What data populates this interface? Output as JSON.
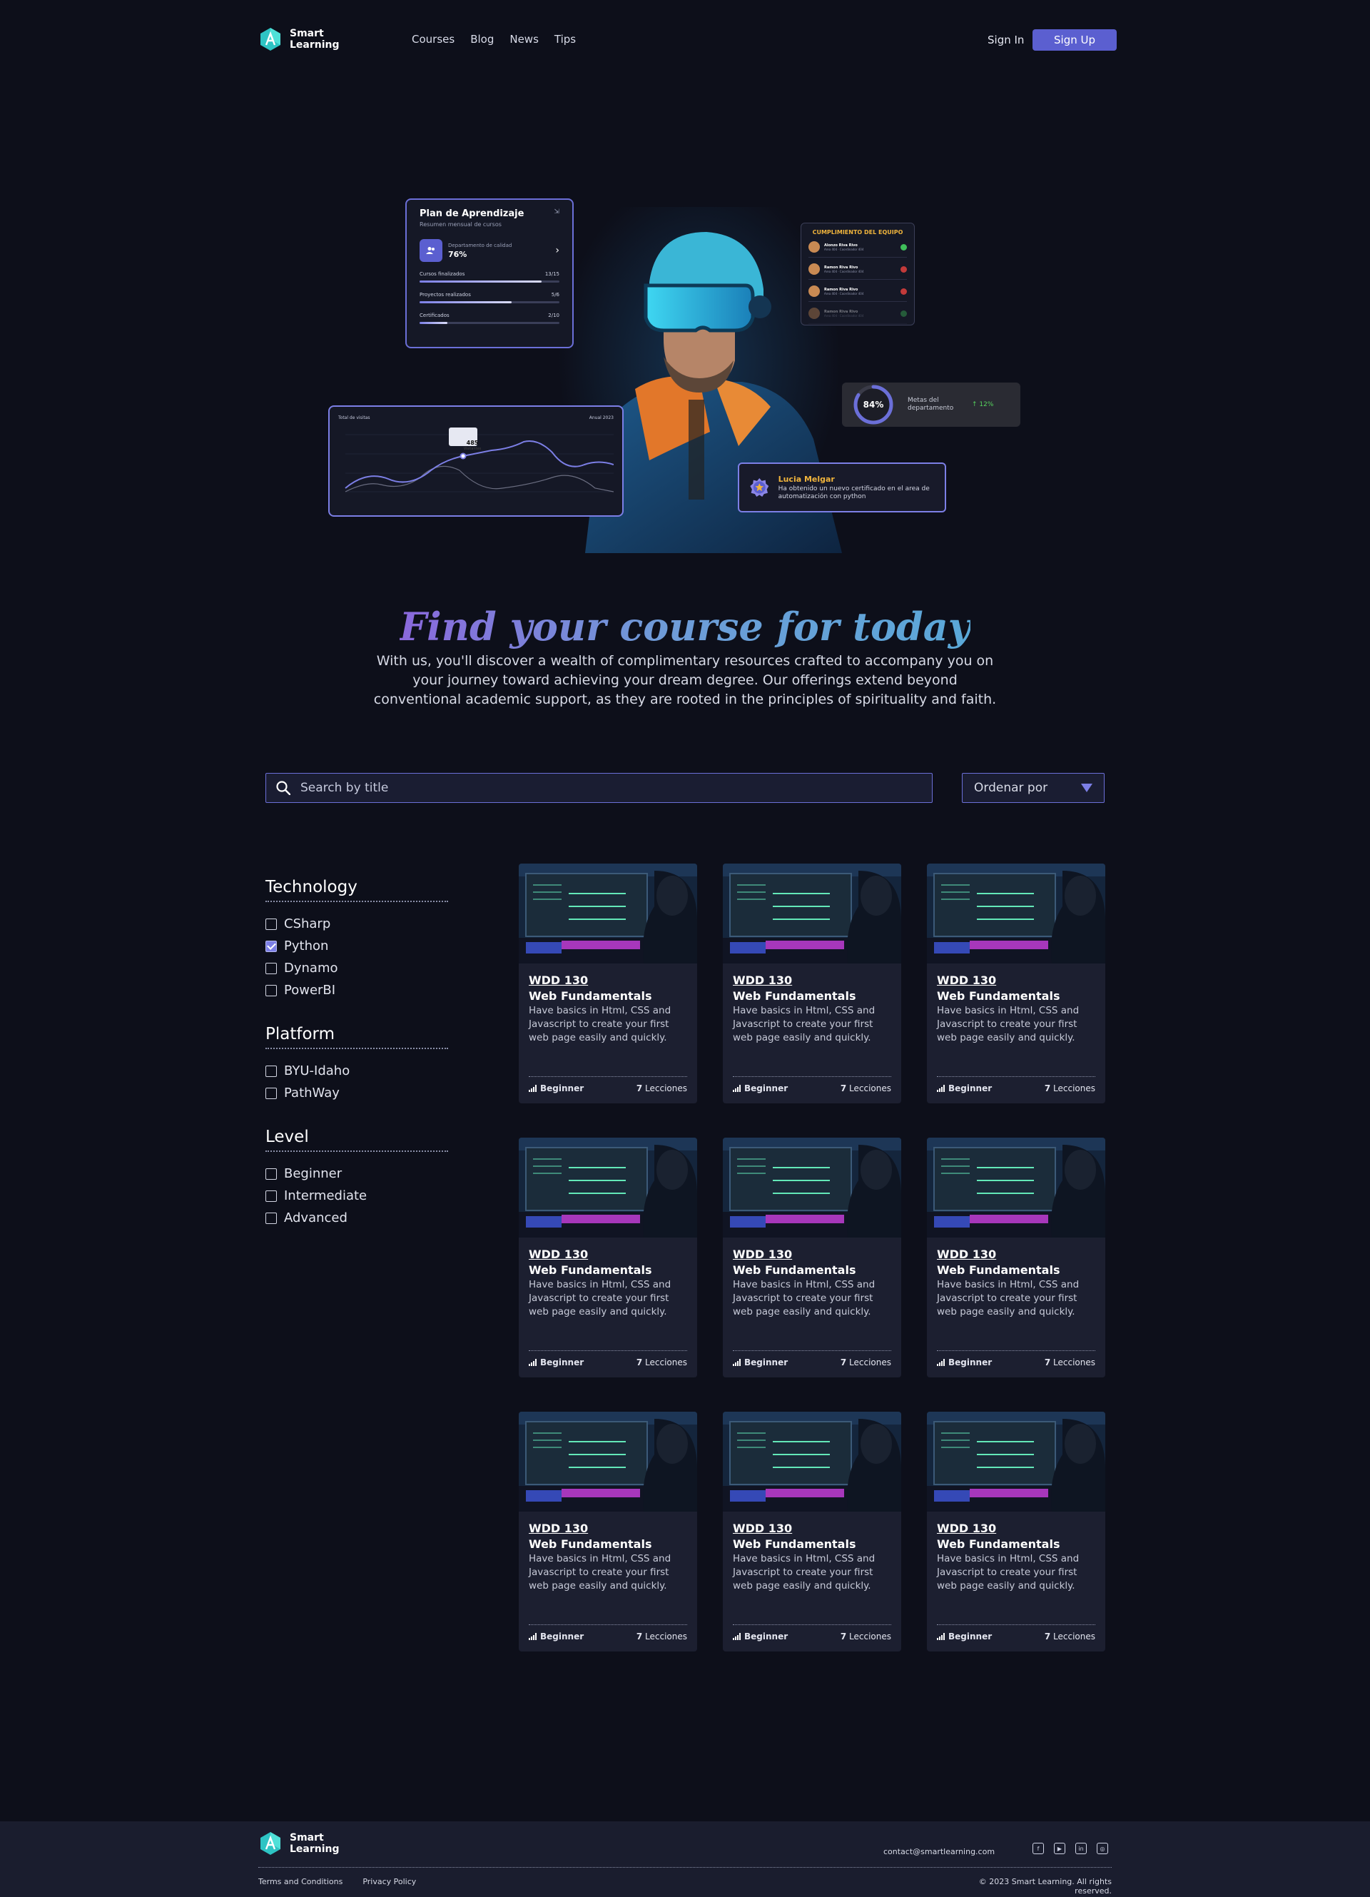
{
  "nav": {
    "logo_line1": "Smart",
    "logo_line2": "Learning",
    "links": [
      "Courses",
      "Blog",
      "News",
      "Tips"
    ],
    "sign_in": "Sign In",
    "sign_up": "Sign Up"
  },
  "hero": {
    "plan_card": {
      "title": "Plan de Aprendizaje",
      "subtitle": "Resumen mensual de cursos",
      "dept_label": "Departamento de calidad",
      "dept_value": "76%",
      "rows": [
        {
          "label": "Cursos finalizados",
          "value": "13/15",
          "progress": 0.87
        },
        {
          "label": "Proyectos realizados",
          "value": "5/6",
          "progress": 0.66
        },
        {
          "label": "Certificados",
          "value": "2/10",
          "progress": 0.2
        }
      ]
    },
    "visits_card": {
      "title": "Total de visitas",
      "range": "Anual 2023",
      "tooltip_value": "485",
      "tooltip_label": "Visitantes"
    },
    "team_card": {
      "title": "CUMPLIMIENTO DEL EQUIPO",
      "members": [
        {
          "name": "Alonzo Riva Rivo",
          "role": "Area 404 · Coordinador 404",
          "status_color": "#3fbf5a"
        },
        {
          "name": "Ramon Riva Rivo",
          "role": "Area 404 · Coordinador 404",
          "status_color": "#c23a3a"
        },
        {
          "name": "Ramon Riva Rivo",
          "role": "Area 404 · Coordinador 404",
          "status_color": "#c23a3a"
        },
        {
          "name": "Ramon Riva Rivo",
          "role": "Area 404 · Coordinador 404",
          "status_color": "#3fbf5a"
        }
      ]
    },
    "goal_card": {
      "value": "84%",
      "progress": 0.84,
      "label": "Metas del departamento",
      "trend": "12%"
    },
    "cert_card": {
      "name": "Lucia Melgar",
      "text": "Ha obtenido un nuevo certificado en el area de automatización con python"
    }
  },
  "headline": "Find your course for today",
  "subheadline": "With us, you'll discover a wealth of complimentary resources crafted to accompany you on your journey toward achieving your dream degree. Our offerings extend beyond conventional academic support, as they are rooted in the principles of spirituality and faith.",
  "search": {
    "placeholder": "Search by title",
    "value": ""
  },
  "sort": {
    "label": "Ordenar por"
  },
  "filters": [
    {
      "title": "Technology",
      "options": [
        {
          "label": "CSharp",
          "checked": false
        },
        {
          "label": "Python",
          "checked": true
        },
        {
          "label": "Dynamo",
          "checked": false
        },
        {
          "label": "PowerBI",
          "checked": false
        }
      ]
    },
    {
      "title": "Platform",
      "options": [
        {
          "label": "BYU-Idaho",
          "checked": false
        },
        {
          "label": "PathWay",
          "checked": false
        }
      ]
    },
    {
      "title": "Level",
      "options": [
        {
          "label": "Beginner",
          "checked": false
        },
        {
          "label": "Intermediate",
          "checked": false
        },
        {
          "label": "Advanced",
          "checked": false
        }
      ]
    }
  ],
  "courses": [
    {
      "code": "WDD 130",
      "title": "Web Fundamentals",
      "desc": "Have basics in Html, CSS and Javascript to create your first web page easily and quickly.",
      "level": "Beginner",
      "lessons_count": "7",
      "lessons_label": "Lecciones"
    },
    {
      "code": "WDD 130",
      "title": "Web Fundamentals",
      "desc": "Have basics in Html, CSS and Javascript to create your first web page easily and quickly.",
      "level": "Beginner",
      "lessons_count": "7",
      "lessons_label": "Lecciones"
    },
    {
      "code": "WDD 130",
      "title": "Web Fundamentals",
      "desc": "Have basics in Html, CSS and Javascript to create your first web page easily and quickly.",
      "level": "Beginner",
      "lessons_count": "7",
      "lessons_label": "Lecciones"
    },
    {
      "code": "WDD 130",
      "title": "Web Fundamentals",
      "desc": "Have basics in Html, CSS and Javascript to create your first web page easily and quickly.",
      "level": "Beginner",
      "lessons_count": "7",
      "lessons_label": "Lecciones"
    },
    {
      "code": "WDD 130",
      "title": "Web Fundamentals",
      "desc": "Have basics in Html, CSS and Javascript to create your first web page easily and quickly.",
      "level": "Beginner",
      "lessons_count": "7",
      "lessons_label": "Lecciones"
    },
    {
      "code": "WDD 130",
      "title": "Web Fundamentals",
      "desc": "Have basics in Html, CSS and Javascript to create your first web page easily and quickly.",
      "level": "Beginner",
      "lessons_count": "7",
      "lessons_label": "Lecciones"
    },
    {
      "code": "WDD 130",
      "title": "Web Fundamentals",
      "desc": "Have basics in Html, CSS and Javascript to create your first web page easily and quickly.",
      "level": "Beginner",
      "lessons_count": "7",
      "lessons_label": "Lecciones"
    },
    {
      "code": "WDD 130",
      "title": "Web Fundamentals",
      "desc": "Have basics in Html, CSS and Javascript to create your first web page easily and quickly.",
      "level": "Beginner",
      "lessons_count": "7",
      "lessons_label": "Lecciones"
    },
    {
      "code": "WDD 130",
      "title": "Web Fundamentals",
      "desc": "Have basics in Html, CSS and Javascript to create your first web page easily and quickly.",
      "level": "Beginner",
      "lessons_count": "7",
      "lessons_label": "Lecciones"
    }
  ],
  "footer": {
    "logo_line1": "Smart",
    "logo_line2": "Learning",
    "email": "contact@smartlearning.com",
    "social_icons": [
      "facebook-icon",
      "youtube-icon",
      "linkedin-icon",
      "instagram-icon"
    ],
    "links": [
      "Terms and Conditions",
      "Privacy Policy"
    ],
    "copyright": "© 2023 Smart Learning. All rights reserved."
  },
  "colors": {
    "accent": "#5b5fd0",
    "background": "#0d0f1a",
    "card": "#1c1f30",
    "gold": "#f0b43c"
  }
}
